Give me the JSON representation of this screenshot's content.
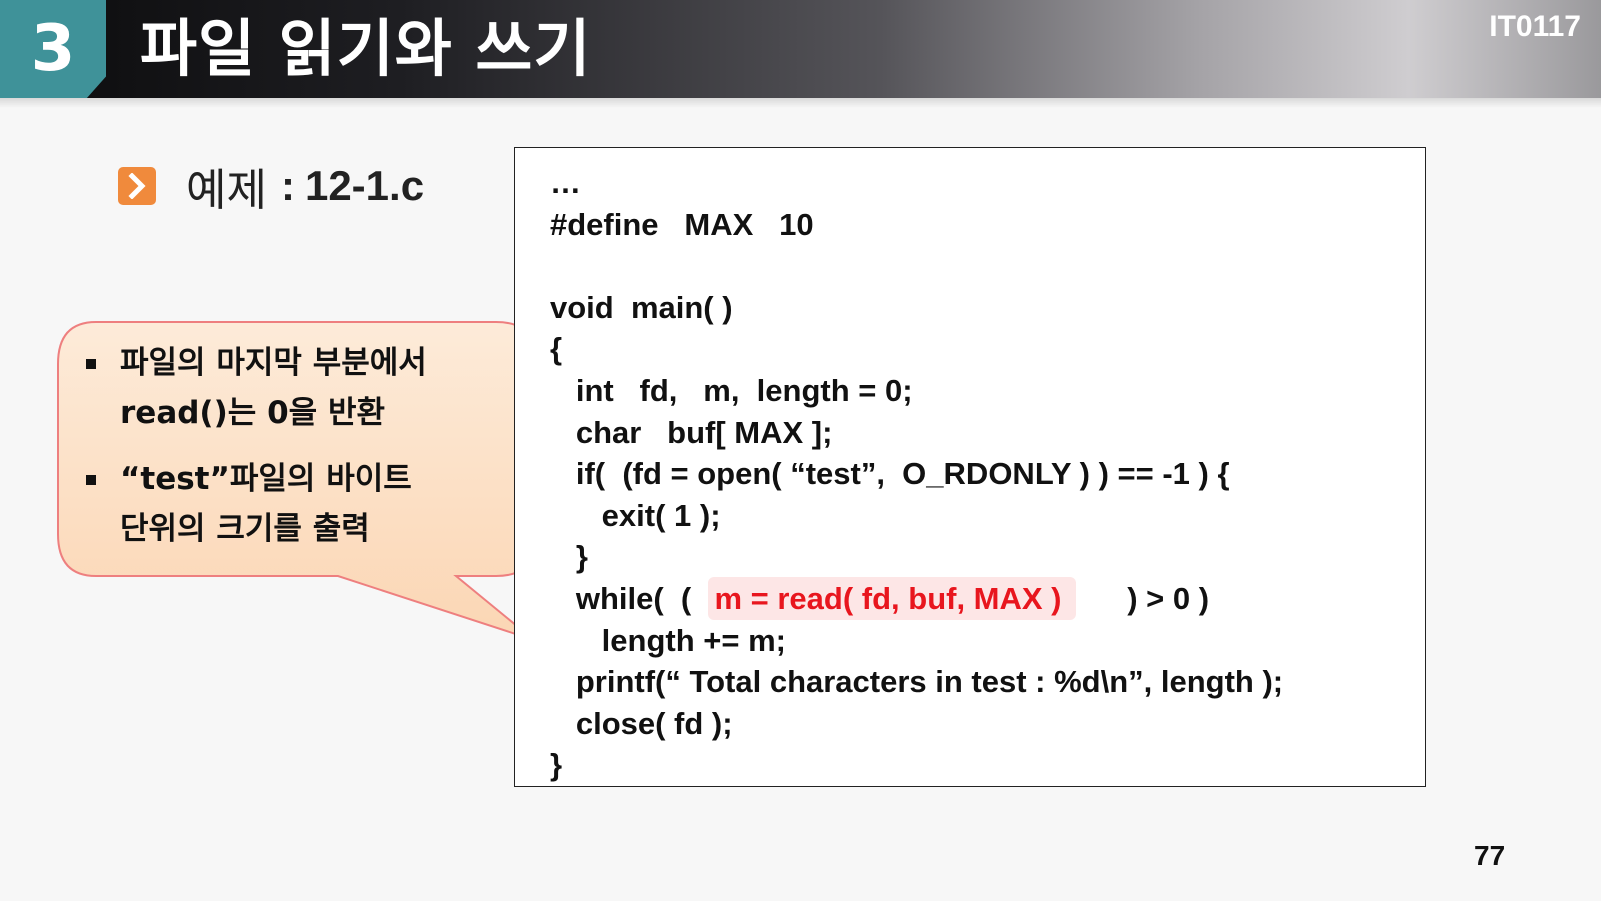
{
  "header": {
    "section_number": "3",
    "title": "파일 읽기와 쓰기",
    "course_code": "IT0117"
  },
  "example": {
    "label": "예제",
    "separator": ":",
    "filename": "12-1.c"
  },
  "callout": {
    "items": [
      {
        "line1": "파일의 마지막 부분에서",
        "line2": "read()는 0을 반환"
      },
      {
        "line1": "“test”파일의 바이트",
        "line2": "단위의 크기를 출력"
      }
    ]
  },
  "code": {
    "lines": [
      "…",
      "#define   MAX   10",
      "",
      "void  main( )",
      "{",
      "   int   fd,   m,  length = 0;",
      "   char   buf[ MAX ];",
      "   if(  (fd = open( “test”,  O_RDONLY ) ) == -1 ) {",
      "      exit( 1 );",
      "   }",
      "   while(  (",
      "      length += m;",
      "   printf(“ Total characters in test : %d\\n”, length );",
      "   close( fd );",
      "}"
    ],
    "while_highlight": "m = read( fd, buf, MAX )",
    "while_tail": ") > 0 )"
  },
  "page_number": "77",
  "colors": {
    "section_box": "#3f9299",
    "accent_orange": "#f08a3c",
    "callout_fill": "#fde2c8",
    "callout_border": "#ee7f7f",
    "highlight_text": "#e8161e"
  }
}
